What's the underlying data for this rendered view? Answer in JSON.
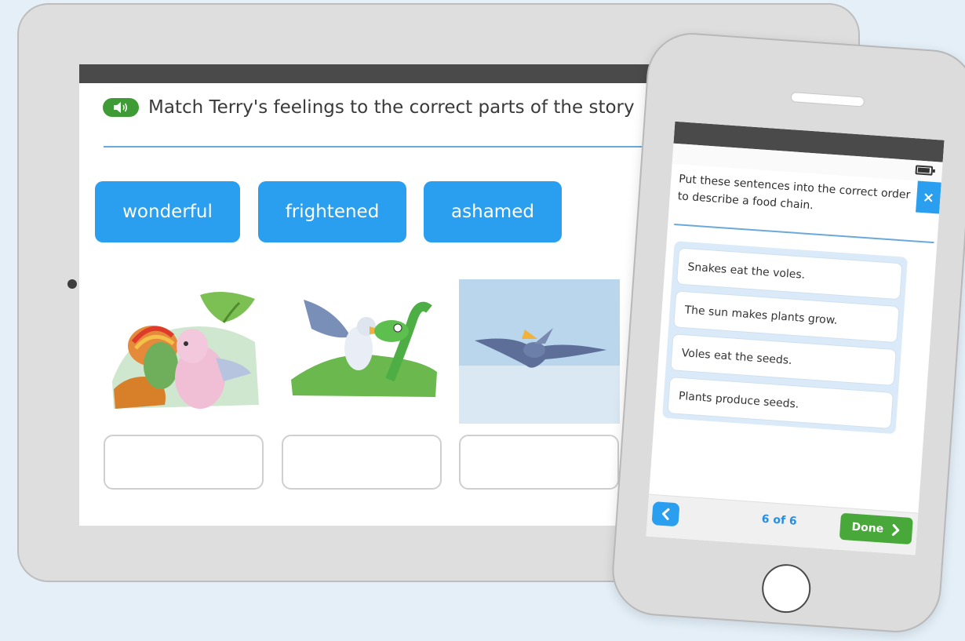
{
  "tablet": {
    "question": "Match Terry's feelings to the correct parts of the story",
    "speaker_icon": "speaker-icon",
    "words": [
      {
        "label": "wonderful"
      },
      {
        "label": "frightened"
      },
      {
        "label": "ashamed"
      }
    ],
    "pictures": [
      "dinosaurs-scene",
      "pterodactyl-and-plesiosaur-scene",
      "flying-pterodactyl-scene"
    ],
    "answer_boxes": 3
  },
  "phone": {
    "question": "Put these sentences into the correct order to describe a food chain.",
    "close_label": "×",
    "sentences": [
      "Snakes eat the voles.",
      "The sun makes plants grow.",
      "Voles eat the seeds.",
      "Plants produce seeds."
    ],
    "page_count": "6 of 6",
    "done_label": "Done",
    "icons": {
      "battery": "battery-icon",
      "back": "chevron-left-icon",
      "forward": "chevron-right-icon"
    }
  },
  "colors": {
    "background": "#e4eff8",
    "accent_blue": "#2a9ff0",
    "accent_green": "#48a83a",
    "top_bar": "#4a4a4a"
  }
}
